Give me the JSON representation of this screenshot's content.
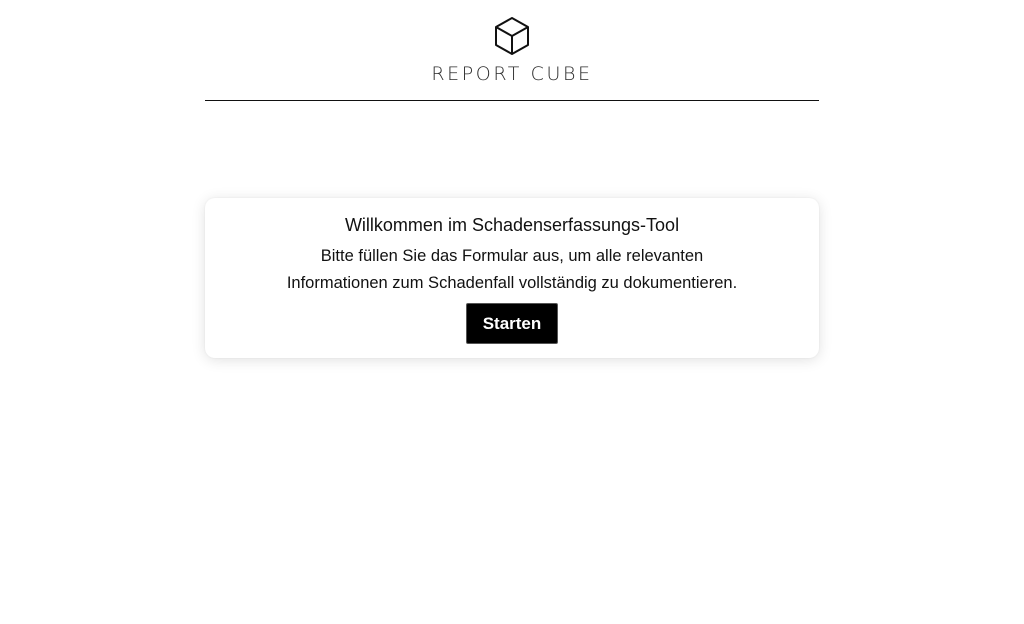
{
  "header": {
    "logo_icon": "cube-icon",
    "brand_name": "REPORT CUBE"
  },
  "welcome_card": {
    "title": "Willkommen im Schadenserfassungs-Tool",
    "description_line1": "Bitte füllen Sie das Formular aus, um alle relevanten",
    "description_line2": "Informationen zum Schadenfall vollständig zu dokumentieren.",
    "start_button_label": "Starten"
  },
  "colors": {
    "background": "#ffffff",
    "text": "#111111",
    "button_background": "#000000",
    "button_text": "#ffffff"
  }
}
